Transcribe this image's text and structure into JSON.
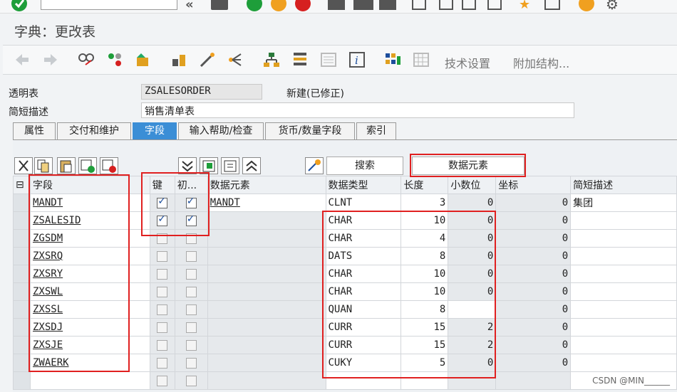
{
  "title": "字典：更改表",
  "toolbar": {
    "settings_label": "技术设置",
    "append_label": "附加结构..."
  },
  "header": {
    "table_label": "透明表",
    "table_name": "ZSALESORDER",
    "status": "新建(已修正)",
    "short_desc_label": "简短描述",
    "short_desc": "销售清单表"
  },
  "tabs": [
    "属性",
    "交付和维护",
    "字段",
    "输入帮助/检查",
    "货币/数量字段",
    "索引"
  ],
  "active_tab": "字段",
  "grid_buttons": {
    "search_label": "搜索",
    "data_element_label": "数据元素"
  },
  "columns": [
    "字段",
    "键",
    "初...",
    "数据元素",
    "数据类型",
    "长度",
    "小数位",
    "坐标",
    "简短描述"
  ],
  "rows": [
    {
      "field": "MANDT",
      "key": true,
      "init": true,
      "element": "MANDT",
      "type": "CLNT",
      "length": "3",
      "decimals": "0",
      "coord": "0",
      "desc": "集团"
    },
    {
      "field": "ZSALESID",
      "key": true,
      "init": true,
      "element": "",
      "type": "CHAR",
      "length": "10",
      "decimals": "0",
      "coord": "0",
      "desc": ""
    },
    {
      "field": "ZGSDM",
      "key": false,
      "init": false,
      "element": "",
      "type": "CHAR",
      "length": "4",
      "decimals": "0",
      "coord": "0",
      "desc": ""
    },
    {
      "field": "ZXSRQ",
      "key": false,
      "init": false,
      "element": "",
      "type": "DATS",
      "length": "8",
      "decimals": "0",
      "coord": "0",
      "desc": ""
    },
    {
      "field": "ZXSRY",
      "key": false,
      "init": false,
      "element": "",
      "type": "CHAR",
      "length": "10",
      "decimals": "0",
      "coord": "0",
      "desc": ""
    },
    {
      "field": "ZXSWL",
      "key": false,
      "init": false,
      "element": "",
      "type": "CHAR",
      "length": "10",
      "decimals": "0",
      "coord": "0",
      "desc": ""
    },
    {
      "field": "ZXSSL",
      "key": false,
      "init": false,
      "element": "",
      "type": "QUAN",
      "length": "8",
      "decimals": "",
      "coord": "0",
      "desc": ""
    },
    {
      "field": "ZXSDJ",
      "key": false,
      "init": false,
      "element": "",
      "type": "CURR",
      "length": "15",
      "decimals": "2",
      "coord": "0",
      "desc": ""
    },
    {
      "field": "ZXSJE",
      "key": false,
      "init": false,
      "element": "",
      "type": "CURR",
      "length": "15",
      "decimals": "2",
      "coord": "0",
      "desc": ""
    },
    {
      "field": "ZWAERK",
      "key": false,
      "init": false,
      "element": "",
      "type": "CUKY",
      "length": "5",
      "decimals": "0",
      "coord": "0",
      "desc": ""
    },
    {
      "field": "",
      "key": false,
      "init": false,
      "element": "",
      "type": "",
      "length": "",
      "decimals": "",
      "coord": "",
      "desc": ""
    }
  ],
  "watermark": "CSDN @MIN______",
  "colors": {
    "accent": "#3b8ed6",
    "highlight": "#e02020",
    "green": "#1e9e3a",
    "orange": "#f0a020",
    "red": "#d62020"
  }
}
